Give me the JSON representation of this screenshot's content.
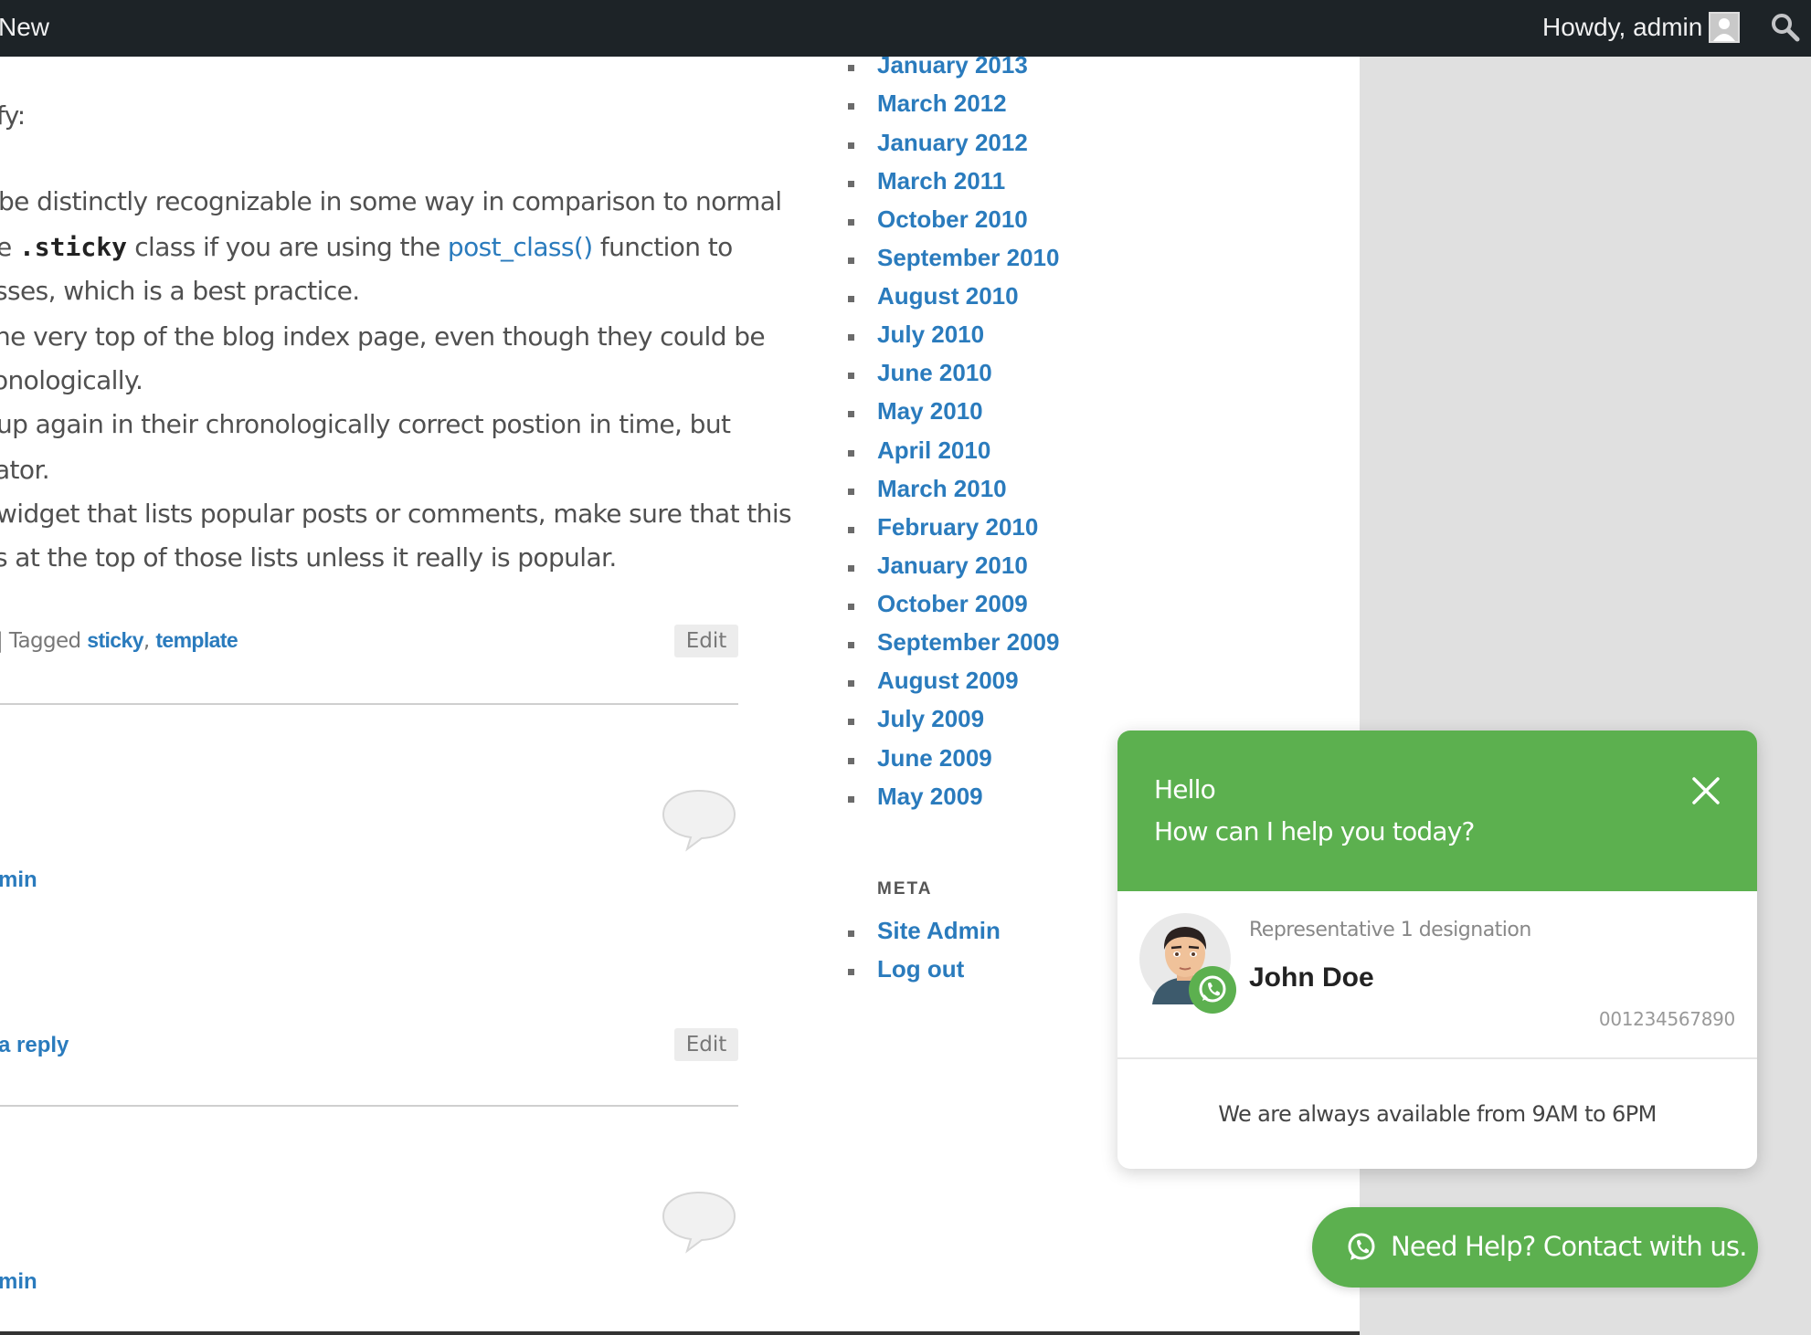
{
  "adminbar": {
    "new_label": "New",
    "howdy_label": "Howdy, admin"
  },
  "post": {
    "lines": [
      "fy:",
      "be distinctly recognizable in some way in comparison to normal",
      "e ",
      ".sticky",
      " class if you are using the ",
      "post_class()",
      " function to",
      "sses, which is a best practice.",
      "he very top of the blog index page, even though they could be",
      "onologically.",
      "up again in their chronologically correct postion in time, but",
      "ator.",
      "widget that lists popular posts or comments, make sure that this",
      "s at the top of those lists unless it really is popular."
    ],
    "tagged_prefix": "| Tagged ",
    "tag_sticky": "sticky",
    "tag_separator": ",",
    "tag_template": "template",
    "edit_label": "Edit",
    "admin_link": "min",
    "reply_link": "a reply",
    "edit_label_2": "Edit",
    "admin_link_2": "min"
  },
  "archives": [
    "January 2013",
    "March 2012",
    "January 2012",
    "March 2011",
    "October 2010",
    "September 2010",
    "August 2010",
    "July 2010",
    "June 2010",
    "May 2010",
    "April 2010",
    "March 2010",
    "February 2010",
    "January 2010",
    "October 2009",
    "September 2009",
    "August 2009",
    "July 2009",
    "June 2009",
    "May 2009"
  ],
  "meta": {
    "title": "META",
    "items": [
      "Site Admin",
      "Log out"
    ]
  },
  "chat": {
    "greeting": "Hello",
    "subtitle": "How can I help you today?",
    "designation": "Representative 1 designation",
    "agent_name": "John Doe",
    "phone": "001234567890",
    "availability": "We are always available from 9AM to 6PM",
    "cta_label": "Need Help? Contact with us."
  },
  "colors": {
    "adminbar_bg": "#1d2327",
    "link_blue": "#2a7bbd",
    "whatsapp_green": "#5cb04f",
    "sidebar_gray": "#e0e0e0"
  },
  "icons": [
    "avatar-icon",
    "search-icon",
    "comment-bubble-icon",
    "close-icon",
    "whatsapp-icon"
  ]
}
